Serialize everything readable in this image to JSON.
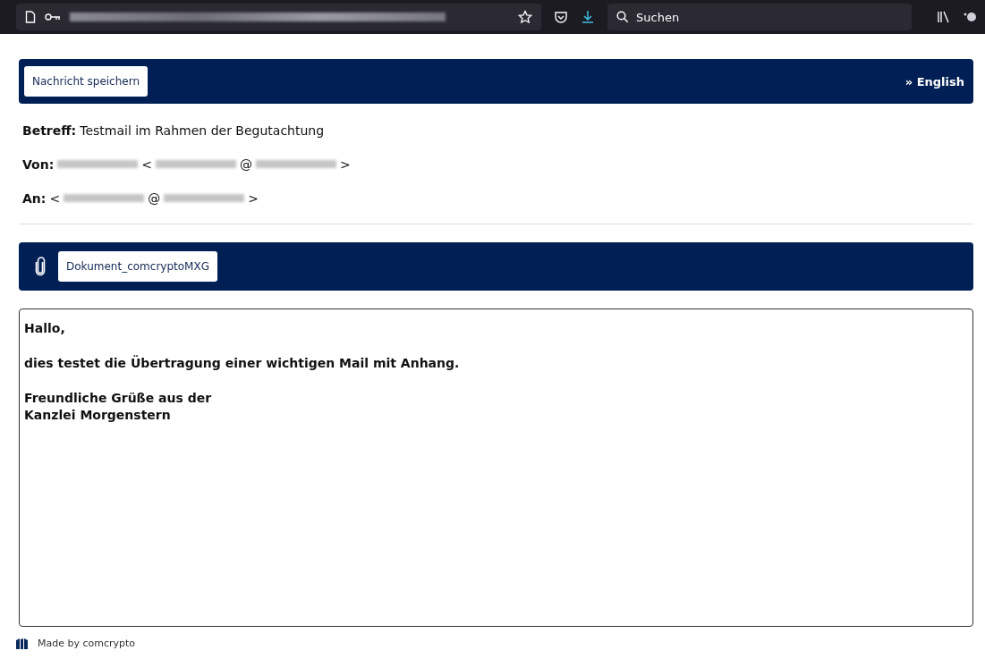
{
  "browser": {
    "url": [
      {
        "kind": "redacted"
      }
    ],
    "search": {
      "placeholder": "Suchen"
    }
  },
  "header": {
    "save_button": "Nachricht speichern",
    "language_link": "» English"
  },
  "fields": [
    {
      "label": "Betreff:",
      "value": [
        {
          "kind": "text",
          "text": "Testmail im Rahmen der Begutachtung"
        }
      ]
    },
    {
      "label": "Von:",
      "value": [
        {
          "kind": "redacted"
        },
        {
          "kind": "text",
          "text": "<"
        },
        {
          "kind": "redacted"
        },
        {
          "kind": "text",
          "text": "@"
        },
        {
          "kind": "redacted"
        },
        {
          "kind": "text",
          "text": ">"
        }
      ]
    },
    {
      "label": "An:",
      "value": [
        {
          "kind": "text",
          "text": "<"
        },
        {
          "kind": "redacted"
        },
        {
          "kind": "text",
          "text": "@"
        },
        {
          "kind": "redacted"
        },
        {
          "kind": "text",
          "text": ">"
        }
      ]
    }
  ],
  "attachments": [
    "Dokument_comcryptoMXG"
  ],
  "body": [
    "Hallo,",
    "dies testet die Übertragung einer wichtigen Mail mit Anhang.",
    "Freundliche Grüße aus der\nKanzlei Morgenstern"
  ],
  "footer": "Made by comcrypto"
}
